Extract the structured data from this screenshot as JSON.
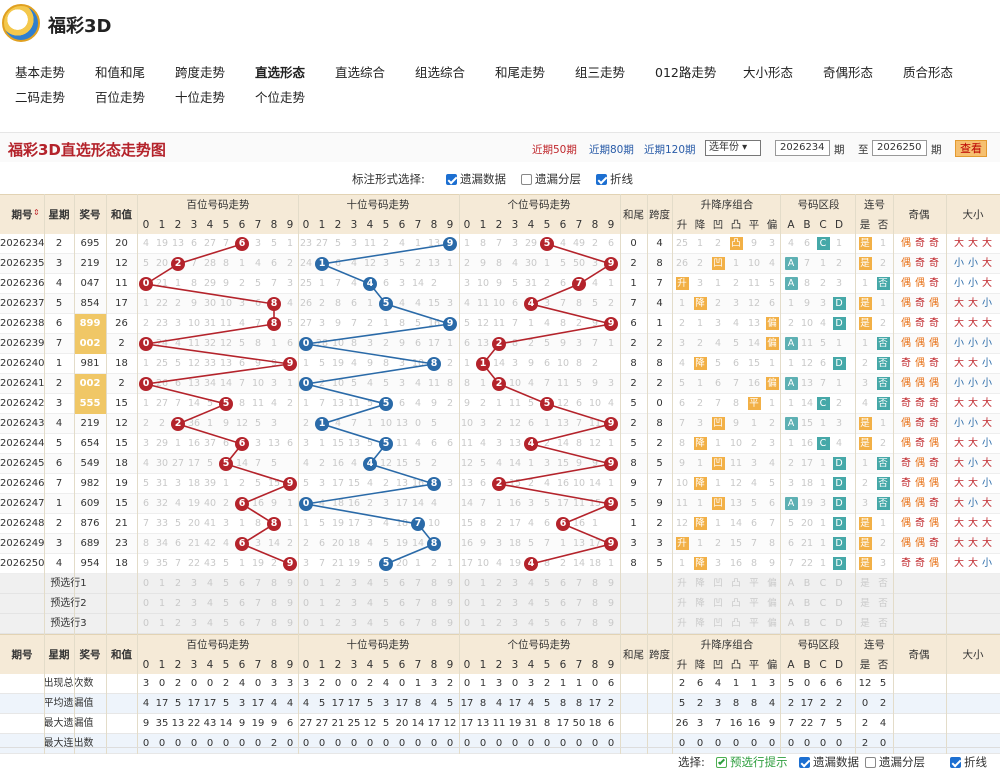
{
  "app": {
    "logo_text": "福彩3D"
  },
  "nav": {
    "row1": [
      "基本走势",
      "和值和尾",
      "跨度走势",
      "直选形态",
      "直选综合",
      "组选综合",
      "和尾走势",
      "组三走势",
      "012路走势",
      "大小形态",
      "奇偶形态",
      "质合形态"
    ],
    "row2": [
      "二码走势",
      "百位走势",
      "十位走势",
      "个位走势"
    ],
    "active": "直选形态"
  },
  "title": "福彩3D直选形态走势图",
  "filters": {
    "recent": [
      "近期50期",
      "近期80期",
      "近期120期"
    ],
    "year_select": "选年份",
    "from": "2026234",
    "to": "2026250",
    "qi": "期",
    "zhi": "至",
    "query": "查看"
  },
  "options": {
    "label": "标注形式选择:",
    "items": [
      {
        "label": "遗漏数据",
        "checked": true
      },
      {
        "label": "遗漏分层",
        "checked": false
      },
      {
        "label": "折线",
        "checked": true
      }
    ]
  },
  "headers": {
    "qihao": "期号",
    "week": "星期",
    "prize": "奖号",
    "sum": "和值",
    "bai": "百位号码走势",
    "shi": "十位号码走势",
    "ge": "个位号码走势",
    "hewei": "和尾",
    "kuadu": "跨度",
    "shengjiang": "升降序组合",
    "haoma": "号码区段",
    "lianhao": "连号",
    "jiou": "奇偶",
    "daxiao": "大小",
    "sj_sub": [
      "升",
      "降",
      "凹",
      "凸",
      "平",
      "偏"
    ],
    "qd_sub": [
      "A",
      "B",
      "C",
      "D"
    ],
    "lh_sub": [
      "是",
      "否"
    ]
  },
  "rows": [
    {
      "q": "2026234",
      "w": "2",
      "p": "695",
      "s": "20",
      "b": [
        4,
        19,
        13,
        6,
        27,
        7,
        6,
        3,
        5,
        1
      ],
      "t": [
        23,
        27,
        5,
        3,
        11,
        2,
        4,
        1,
        13,
        9
      ],
      "g": [
        1,
        8,
        7,
        3,
        29,
        5,
        4,
        49,
        2,
        6
      ],
      "hw": "0",
      "kd": "4",
      "sj": [
        "25",
        "1",
        "2",
        "凸",
        "9",
        "3"
      ],
      "qd": [
        "4",
        "6",
        "C",
        "1"
      ],
      "lh": "是",
      "lhn": "1",
      "jo": [
        "偶",
        "奇",
        "奇"
      ],
      "dx": [
        "大",
        "大",
        "大"
      ]
    },
    {
      "q": "2026235",
      "w": "3",
      "p": "219",
      "s": "12",
      "b": [
        5,
        20,
        2,
        7,
        28,
        8,
        1,
        4,
        6,
        2
      ],
      "t": [
        24,
        1,
        6,
        4,
        12,
        3,
        5,
        2,
        13,
        1
      ],
      "g": [
        2,
        9,
        8,
        4,
        30,
        1,
        5,
        50,
        3,
        9
      ],
      "hw": "2",
      "kd": "8",
      "sj": [
        "26",
        "2",
        "凹",
        "1",
        "10",
        "4"
      ],
      "qd": [
        "A",
        "7",
        "1",
        "2"
      ],
      "lh": "是",
      "lhn": "2",
      "jo": [
        "偶",
        "奇",
        "奇"
      ],
      "dx": [
        "小",
        "小",
        "大"
      ]
    },
    {
      "q": "2026236",
      "w": "4",
      "p": "047",
      "s": "11",
      "b": [
        0,
        21,
        1,
        8,
        29,
        9,
        2,
        5,
        7,
        3
      ],
      "t": [
        25,
        1,
        7,
        4,
        4,
        6,
        3,
        14,
        2
      ],
      "g": [
        3,
        10,
        9,
        5,
        31,
        2,
        6,
        7,
        4,
        1
      ],
      "hw": "1",
      "kd": "7",
      "sj": [
        "升",
        "3",
        "1",
        "2",
        "11",
        "5"
      ],
      "qd": [
        "A",
        "8",
        "2",
        "3"
      ],
      "lh": "否",
      "lhn": "1",
      "jo": [
        "偶",
        "偶",
        "奇"
      ],
      "dx": [
        "小",
        "小",
        "大"
      ]
    },
    {
      "q": "2026237",
      "w": "5",
      "p": "854",
      "s": "17",
      "b": [
        1,
        22,
        2,
        9,
        30,
        10,
        3,
        6,
        8,
        4
      ],
      "t": [
        26,
        2,
        8,
        6,
        1,
        5,
        4,
        4,
        15,
        3
      ],
      "g": [
        4,
        11,
        10,
        6,
        4,
        3,
        7,
        8,
        5,
        2
      ],
      "hw": "7",
      "kd": "4",
      "sj": [
        "1",
        "降",
        "2",
        "3",
        "12",
        "6"
      ],
      "qd": [
        "1",
        "9",
        "3",
        "D"
      ],
      "lh": "是",
      "lhn": "1",
      "jo": [
        "偶",
        "奇",
        "偶"
      ],
      "dx": [
        "大",
        "大",
        "小"
      ]
    },
    {
      "q": "2026238",
      "w": "6",
      "p": "899",
      "s": "26",
      "b": [
        2,
        23,
        3,
        10,
        31,
        11,
        4,
        7,
        8,
        5
      ],
      "t": [
        27,
        3,
        9,
        7,
        2,
        1,
        8,
        5,
        16,
        9
      ],
      "g": [
        5,
        12,
        11,
        7,
        1,
        4,
        8,
        2,
        9
      ],
      "hw": "6",
      "kd": "1",
      "sj": [
        "2",
        "1",
        "3",
        "4",
        "13",
        "偏"
      ],
      "qd": [
        "2",
        "10",
        "4",
        "D"
      ],
      "lh": "是",
      "lhn": "2",
      "jo": [
        "偶",
        "奇",
        "奇"
      ],
      "dx": [
        "大",
        "大",
        "大"
      ]
    },
    {
      "q": "2026239",
      "w": "7",
      "p": "002",
      "s": "2",
      "b": [
        0,
        24,
        4,
        11,
        32,
        12,
        5,
        8,
        1,
        6
      ],
      "t": [
        0,
        28,
        10,
        8,
        3,
        2,
        9,
        6,
        17,
        1
      ],
      "g": [
        6,
        13,
        2,
        8,
        2,
        5,
        9,
        3,
        7,
        1
      ],
      "hw": "2",
      "kd": "2",
      "sj": [
        "3",
        "2",
        "4",
        "5",
        "14",
        "偏"
      ],
      "qd": [
        "A",
        "11",
        "5",
        "1"
      ],
      "lh": "否",
      "lhn": "1",
      "jo": [
        "偶",
        "偶",
        "偶"
      ],
      "dx": [
        "小",
        "小",
        "小"
      ]
    },
    {
      "q": "2026240",
      "w": "1",
      "p": "981",
      "s": "18",
      "b": [
        1,
        25,
        5,
        12,
        33,
        13,
        6,
        9,
        9,
        7
      ],
      "t": [
        1,
        5,
        19,
        4,
        9,
        8,
        3,
        10,
        7,
        2
      ],
      "g": [
        1,
        7,
        14,
        3,
        9,
        6,
        10,
        8,
        2
      ],
      "hw": "8",
      "kd": "8",
      "sj": [
        "4",
        "降",
        "5",
        "6",
        "15",
        "1"
      ],
      "qd": [
        "1",
        "12",
        "6",
        "D"
      ],
      "lh": "否",
      "lhn": "2",
      "jo": [
        "奇",
        "偶",
        "奇"
      ],
      "dx": [
        "大",
        "大",
        "小"
      ]
    },
    {
      "q": "2026241",
      "w": "2",
      "p": "002",
      "s": "2",
      "b": [
        0,
        26,
        6,
        13,
        34,
        14,
        7,
        10,
        3,
        1
      ],
      "t": [
        0,
        2,
        10,
        5,
        4,
        5,
        3,
        4,
        11,
        8,
        1
      ],
      "g": [
        8,
        1,
        2,
        10,
        4,
        7,
        11,
        5,
        9,
        3
      ],
      "hw": "2",
      "kd": "2",
      "sj": [
        "5",
        "1",
        "6",
        "7",
        "16",
        "偏"
      ],
      "qd": [
        "A",
        "13",
        "7",
        "1"
      ],
      "lh": "否",
      "lhn": "3",
      "jo": [
        "偶",
        "偶",
        "偶"
      ],
      "dx": [
        "小",
        "小",
        "小"
      ]
    },
    {
      "q": "2026242",
      "w": "3",
      "p": "555",
      "s": "15",
      "b": [
        1,
        27,
        7,
        14,
        5,
        15,
        8,
        11,
        4,
        2
      ],
      "t": [
        1,
        7,
        13,
        11,
        5,
        2,
        6,
        4,
        9,
        2
      ],
      "g": [
        9,
        2,
        1,
        11,
        5,
        2,
        12,
        6,
        10,
        4
      ],
      "hw": "5",
      "kd": "0",
      "sj": [
        "6",
        "2",
        "7",
        "8",
        "平",
        "1"
      ],
      "qd": [
        "1",
        "14",
        "C",
        "2"
      ],
      "lh": "否",
      "lhn": "4",
      "jo": [
        "奇",
        "奇",
        "奇"
      ],
      "dx": [
        "大",
        "大",
        "大"
      ]
    },
    {
      "q": "2026243",
      "w": "4",
      "p": "219",
      "s": "12",
      "b": [
        2,
        2,
        28,
        36,
        1,
        9,
        12,
        5,
        3
      ],
      "t": [
        2,
        1,
        4,
        7,
        1,
        10,
        13,
        0,
        5
      ],
      "g": [
        10,
        3,
        2,
        12,
        6,
        1,
        13,
        7,
        11,
        9
      ],
      "hw": "2",
      "kd": "8",
      "sj": [
        "7",
        "3",
        "凹",
        "9",
        "1",
        "2"
      ],
      "qd": [
        "A",
        "15",
        "1",
        "3"
      ],
      "lh": "是",
      "lhn": "1",
      "jo": [
        "偶",
        "奇",
        "奇"
      ],
      "dx": [
        "小",
        "小",
        "大"
      ]
    },
    {
      "q": "2026244",
      "w": "5",
      "p": "654",
      "s": "15",
      "b": [
        3,
        29,
        1,
        16,
        37,
        6,
        2,
        3,
        13,
        6
      ],
      "t": [
        3,
        1,
        15,
        13,
        5,
        14,
        11,
        4,
        6,
        6
      ],
      "g": [
        11,
        4,
        3,
        13,
        4,
        2,
        14,
        8,
        12,
        1
      ],
      "hw": "5",
      "kd": "2",
      "sj": [
        "8",
        "降",
        "1",
        "10",
        "2",
        "3"
      ],
      "qd": [
        "1",
        "16",
        "C",
        "4"
      ],
      "lh": "是",
      "lhn": "2",
      "jo": [
        "偶",
        "奇",
        "偶"
      ],
      "dx": [
        "大",
        "大",
        "小"
      ]
    },
    {
      "q": "2026245",
      "w": "6",
      "p": "549",
      "s": "18",
      "b": [
        4,
        30,
        27,
        17,
        5,
        1,
        14,
        7,
        5
      ],
      "t": [
        4,
        2,
        16,
        4,
        4,
        12,
        15,
        5,
        2
      ],
      "g": [
        12,
        5,
        4,
        14,
        1,
        3,
        15,
        9,
        9
      ],
      "hw": "8",
      "kd": "5",
      "sj": [
        "9",
        "1",
        "凹",
        "11",
        "3",
        "4"
      ],
      "qd": [
        "2",
        "17",
        "1",
        "D"
      ],
      "lh": "否",
      "lhn": "1",
      "jo": [
        "奇",
        "偶",
        "奇"
      ],
      "dx": [
        "大",
        "小",
        "大"
      ]
    },
    {
      "q": "2026246",
      "w": "7",
      "p": "982",
      "s": "19",
      "b": [
        5,
        31,
        3,
        18,
        39,
        1,
        2,
        5,
        15,
        9
      ],
      "t": [
        5,
        3,
        17,
        15,
        4,
        2,
        13,
        16,
        8,
        3
      ],
      "g": [
        13,
        6,
        2,
        15,
        2,
        4,
        16,
        10,
        14,
        1
      ],
      "hw": "9",
      "kd": "7",
      "sj": [
        "10",
        "降",
        "1",
        "12",
        "4",
        "5"
      ],
      "qd": [
        "3",
        "18",
        "1",
        "D"
      ],
      "lh": "否",
      "lhn": "2",
      "jo": [
        "奇",
        "偶",
        "偶"
      ],
      "dx": [
        "大",
        "大",
        "小"
      ]
    },
    {
      "q": "2026247",
      "w": "1",
      "p": "609",
      "s": "15",
      "b": [
        6,
        32,
        4,
        19,
        40,
        2,
        6,
        16,
        9,
        1
      ],
      "t": [
        0,
        4,
        18,
        16,
        2,
        3,
        17,
        14,
        4
      ],
      "g": [
        14,
        7,
        1,
        16,
        3,
        5,
        17,
        11,
        15,
        9
      ],
      "hw": "5",
      "kd": "9",
      "sj": [
        "11",
        "1",
        "凹",
        "13",
        "5",
        "6"
      ],
      "qd": [
        "A",
        "19",
        "3",
        "D"
      ],
      "lh": "否",
      "lhn": "3",
      "jo": [
        "偶",
        "偶",
        "奇"
      ],
      "dx": [
        "大",
        "小",
        "大"
      ]
    },
    {
      "q": "2026248",
      "w": "2",
      "p": "876",
      "s": "21",
      "b": [
        7,
        33,
        5,
        20,
        41,
        3,
        1,
        8,
        2,
        1
      ],
      "t": [
        1,
        5,
        19,
        17,
        3,
        4,
        18,
        7,
        10
      ],
      "g": [
        15,
        8,
        2,
        17,
        4,
        6,
        12,
        16,
        1
      ],
      "hw": "1",
      "kd": "2",
      "sj": [
        "12",
        "降",
        "1",
        "14",
        "6",
        "7"
      ],
      "qd": [
        "5",
        "20",
        "1",
        "D"
      ],
      "lh": "是",
      "lhn": "1",
      "jo": [
        "偶",
        "奇",
        "偶"
      ],
      "dx": [
        "大",
        "大",
        "大"
      ]
    },
    {
      "q": "2026249",
      "w": "3",
      "p": "689",
      "s": "23",
      "b": [
        8,
        34,
        6,
        21,
        42,
        4,
        6,
        3,
        14,
        2
      ],
      "t": [
        2,
        6,
        20,
        18,
        4,
        5,
        19,
        14,
        8
      ],
      "g": [
        16,
        9,
        3,
        18,
        5,
        7,
        1,
        13,
        17,
        9
      ],
      "hw": "3",
      "kd": "3",
      "sj": [
        "升",
        "1",
        "2",
        "15",
        "7",
        "8"
      ],
      "qd": [
        "6",
        "21",
        "1",
        "D"
      ],
      "lh": "是",
      "lhn": "2",
      "jo": [
        "偶",
        "偶",
        "奇"
      ],
      "dx": [
        "大",
        "大",
        "大"
      ]
    },
    {
      "q": "2026250",
      "w": "4",
      "p": "954",
      "s": "18",
      "b": [
        9,
        35,
        7,
        22,
        43,
        5,
        1,
        19,
        2,
        9
      ],
      "t": [
        3,
        7,
        21,
        19,
        5,
        6,
        20,
        1,
        2,
        1
      ],
      "g": [
        17,
        10,
        4,
        19,
        4,
        8,
        2,
        14,
        18,
        1
      ],
      "hw": "8",
      "kd": "5",
      "sj": [
        "1",
        "降",
        "3",
        "16",
        "8",
        "9"
      ],
      "qd": [
        "7",
        "22",
        "1",
        "D"
      ],
      "lh": "是",
      "lhn": "3",
      "jo": [
        "奇",
        "奇",
        "偶"
      ],
      "dx": [
        "大",
        "大",
        "小"
      ]
    }
  ],
  "preselect": [
    "预选行1",
    "预选行2",
    "预选行3"
  ],
  "digits": [
    "0",
    "1",
    "2",
    "3",
    "4",
    "5",
    "6",
    "7",
    "8",
    "9"
  ],
  "stats": [
    {
      "label": "出现总次数",
      "b": [
        "3",
        "0",
        "2",
        "0",
        "0",
        "2",
        "4",
        "0",
        "3",
        "3"
      ],
      "t": [
        "3",
        "2",
        "0",
        "0",
        "2",
        "4",
        "0",
        "1",
        "3",
        "2"
      ],
      "g": [
        "0",
        "1",
        "3",
        "0",
        "3",
        "2",
        "1",
        "1",
        "0",
        "6"
      ],
      "sj": [
        "2",
        "6",
        "4",
        "1",
        "1",
        "3"
      ],
      "qd": [
        "5",
        "0",
        "6",
        "6"
      ],
      "lh": [
        "12",
        "5"
      ]
    },
    {
      "label": "平均遗漏值",
      "b": [
        "4",
        "17",
        "5",
        "17",
        "17",
        "5",
        "3",
        "17",
        "4",
        "4"
      ],
      "t": [
        "4",
        "5",
        "17",
        "17",
        "5",
        "3",
        "17",
        "8",
        "4",
        "5"
      ],
      "g": [
        "17",
        "8",
        "4",
        "17",
        "4",
        "5",
        "8",
        "8",
        "17",
        "2"
      ],
      "sj": [
        "5",
        "2",
        "3",
        "8",
        "8",
        "4"
      ],
      "qd": [
        "2",
        "17",
        "2",
        "2"
      ],
      "lh": [
        "0",
        "2"
      ]
    },
    {
      "label": "最大遗漏值",
      "b": [
        "9",
        "35",
        "13",
        "22",
        "43",
        "14",
        "9",
        "19",
        "9",
        "6"
      ],
      "t": [
        "27",
        "27",
        "21",
        "25",
        "12",
        "5",
        "20",
        "14",
        "17",
        "12"
      ],
      "g": [
        "17",
        "13",
        "11",
        "19",
        "31",
        "8",
        "17",
        "50",
        "18",
        "6"
      ],
      "sj": [
        "26",
        "3",
        "7",
        "16",
        "16",
        "9"
      ],
      "qd": [
        "7",
        "22",
        "7",
        "5"
      ],
      "lh": [
        "2",
        "4"
      ]
    },
    {
      "label": "最大连出数",
      "b": [
        "0",
        "0",
        "0",
        "0",
        "0",
        "0",
        "0",
        "0",
        "2",
        "0"
      ],
      "t": [
        "0",
        "0",
        "0",
        "0",
        "0",
        "0",
        "0",
        "0",
        "0",
        "0"
      ],
      "g": [
        "0",
        "0",
        "0",
        "0",
        "0",
        "0",
        "0",
        "0",
        "0",
        "0"
      ],
      "sj": [
        "0",
        "0",
        "0",
        "0",
        "0",
        "0"
      ],
      "qd": [
        "0",
        "0",
        "0",
        "0"
      ],
      "lh": [
        "2",
        "0"
      ]
    }
  ],
  "footer": {
    "label": "选择:",
    "items": [
      {
        "label": "预选行提示",
        "checked": true,
        "green": true
      },
      {
        "label": "遗漏数据",
        "checked": true
      },
      {
        "label": "遗漏分层",
        "checked": false
      },
      {
        "label": "折线",
        "checked": true
      }
    ]
  },
  "colors": {
    "red": "#b4232b",
    "blue": "#2a6aa8",
    "header_bg": "#f5ead7",
    "highlight": "#f0c766"
  }
}
